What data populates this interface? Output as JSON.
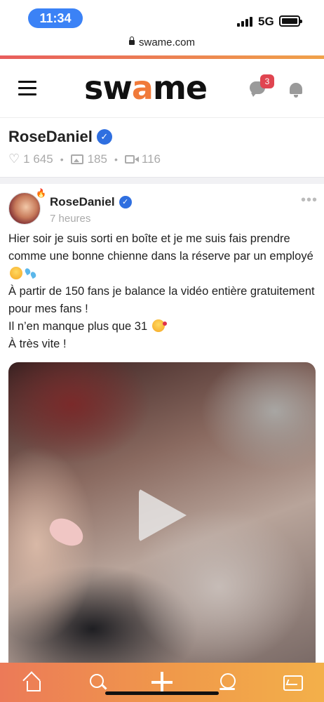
{
  "status_bar": {
    "time": "11:34",
    "network": "5G"
  },
  "browser": {
    "url": "swame.com"
  },
  "header": {
    "logo_prefix": "sw",
    "logo_accent": "a",
    "logo_suffix": "me",
    "messages_badge": "3",
    "accent_color": "#f07a3a"
  },
  "profile": {
    "name": "RoseDaniel",
    "likes": "1 645",
    "photos": "185",
    "videos": "116"
  },
  "post": {
    "author": "RoseDaniel",
    "time": "7 heures",
    "more": "•••",
    "line1": "Hier soir je suis sorti en boîte  et je me suis fais prendre comme une bonne chienne dans la réserve par un employé",
    "line2": "À partir de 150 fans je balance la vidéo entière gratuitement pour mes fans !",
    "line3": "Il n’en manque plus que 31",
    "line4": " À très vite !"
  },
  "bottom_nav": {
    "items": [
      "home-icon",
      "search-icon",
      "plus-icon",
      "live-icon",
      "stats-icon"
    ]
  }
}
